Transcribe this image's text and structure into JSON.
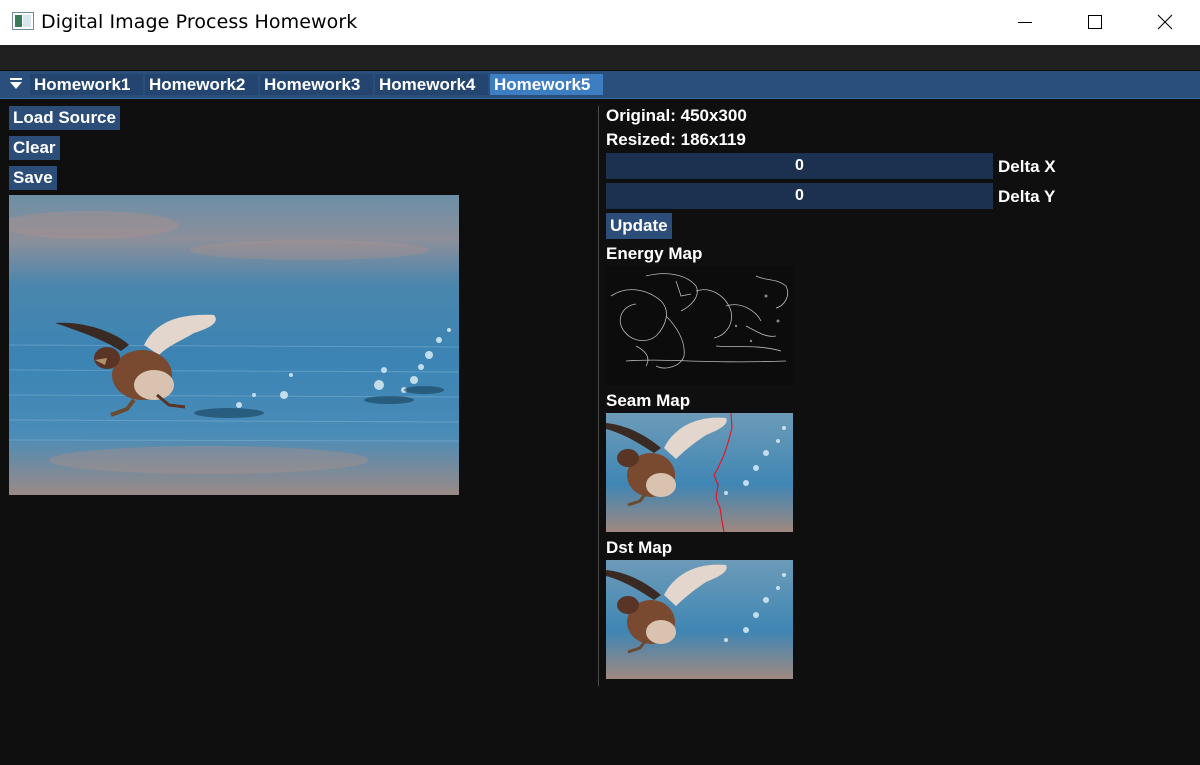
{
  "window": {
    "title": "Digital Image Process Homework",
    "app_icon": "window-app-icon",
    "controls": [
      "minimize-icon",
      "maximize-icon",
      "close-icon"
    ]
  },
  "menu": {
    "collapse_icon": "triangle-down-icon",
    "tabs": [
      {
        "label": "Homework1",
        "active": false
      },
      {
        "label": "Homework2",
        "active": false
      },
      {
        "label": "Homework3",
        "active": false
      },
      {
        "label": "Homework4",
        "active": false
      },
      {
        "label": "Homework5",
        "active": true
      }
    ]
  },
  "left": {
    "load_label": "Load Source",
    "clear_label": "Clear",
    "save_label": "Save"
  },
  "right": {
    "original": "Original: 450x300",
    "resized": "Resized: 186x119",
    "delta_x_value": "0",
    "delta_x_label": "Delta X",
    "delta_y_value": "0",
    "delta_y_label": "Delta Y",
    "update_label": "Update",
    "energy_title": "Energy Map",
    "seam_title": "Seam Map",
    "dst_title": "Dst Map"
  },
  "colors": {
    "accent": "#2a4f7c",
    "active_tab": "#3d7ec2",
    "background": "#0f0f0f",
    "seam": "#e0182a"
  }
}
